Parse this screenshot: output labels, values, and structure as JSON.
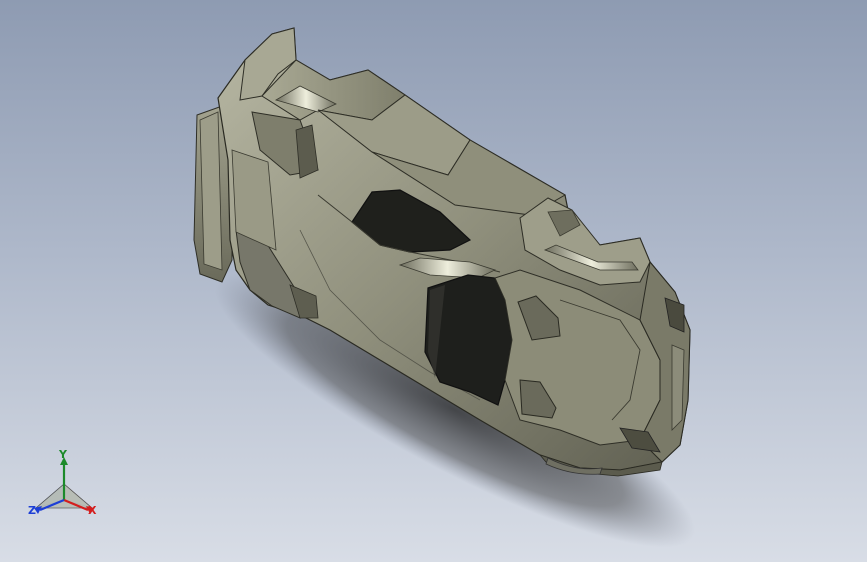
{
  "viewport": {
    "background_top": "#8e9bb2",
    "background_bottom": "#d8dde6",
    "model": {
      "name": "sports-car-body",
      "body_color": "#8a8a78",
      "glass_color": "#1e1f1c"
    }
  },
  "triad": {
    "y_label": "Y",
    "x_label": "X",
    "z_label": "Z",
    "y_color": "#1c8a2a",
    "x_color": "#d41e1e",
    "z_color": "#1d3fd6"
  }
}
